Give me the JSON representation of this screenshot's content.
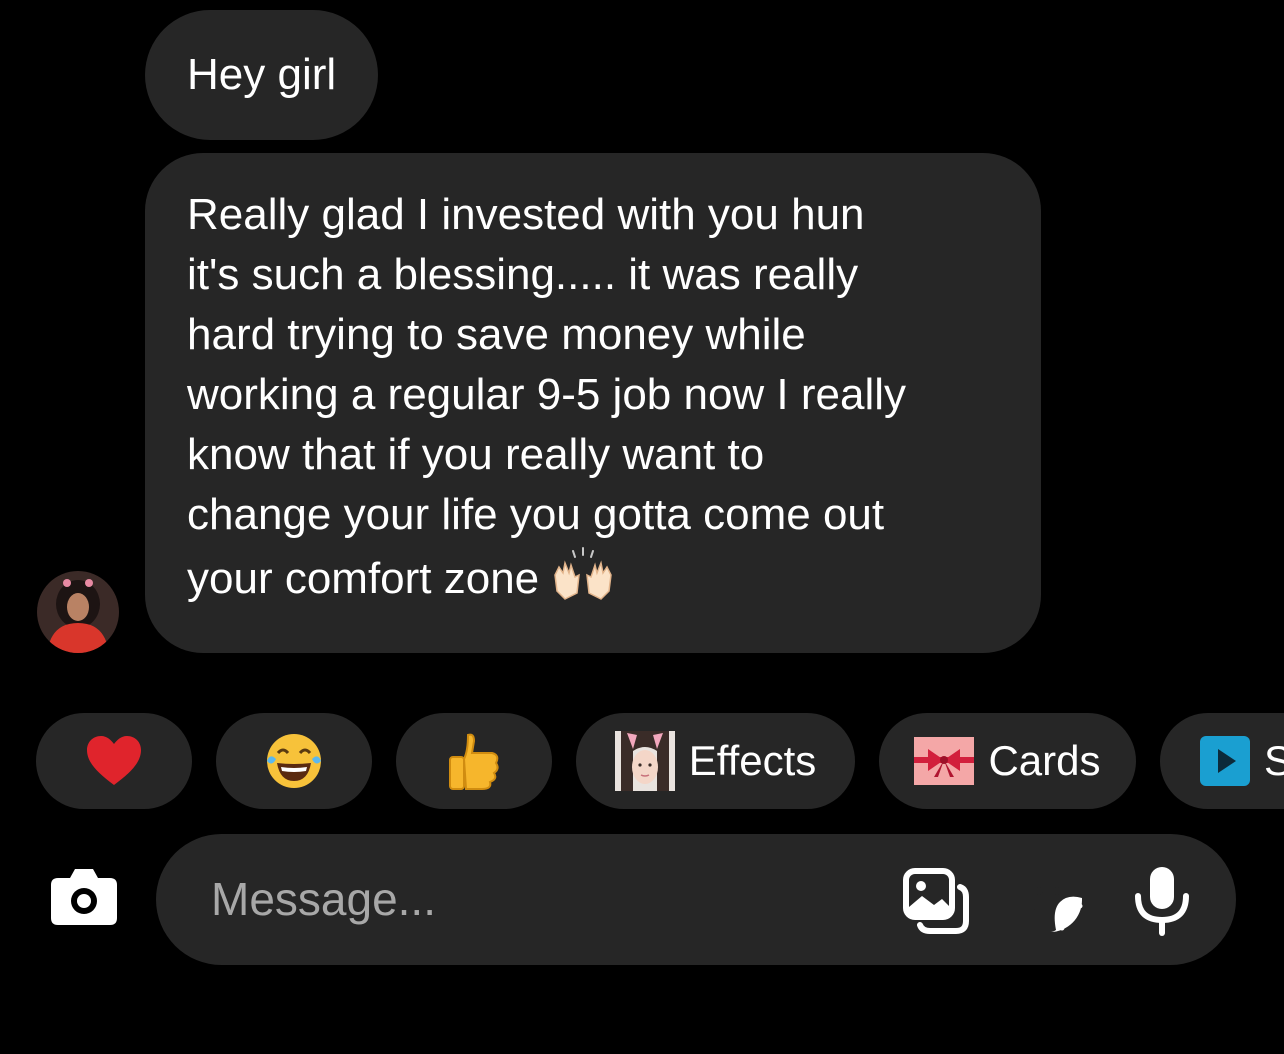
{
  "messages": [
    {
      "text": "Hey girl"
    },
    {
      "text": "Really glad I invested with you hun\nit's such a blessing..... it was really\nhard trying to save money while\nworking a regular 9-5 job now I really\nknow that if you really want to\nchange your life you gotta come out\nyour comfort zone",
      "emoji": "🙌"
    }
  ],
  "quick_reactions": [
    "❤️",
    "😂",
    "👍"
  ],
  "chips": [
    {
      "label": "Effects",
      "icon": "bunny-face-thumbnail"
    },
    {
      "label": "Cards",
      "icon": "gift-ribbon-icon"
    },
    {
      "label": "S",
      "icon": "play-icon"
    }
  ],
  "composer": {
    "placeholder": "Message...",
    "icons": [
      "camera-icon",
      "gallery-icon",
      "sticker-icon",
      "microphone-icon"
    ]
  },
  "colors": {
    "background": "#000000",
    "bubble": "#262626",
    "placeholder": "#a8a8a8",
    "heart": "#e0242c",
    "play_icon": "#1a9fd1"
  }
}
